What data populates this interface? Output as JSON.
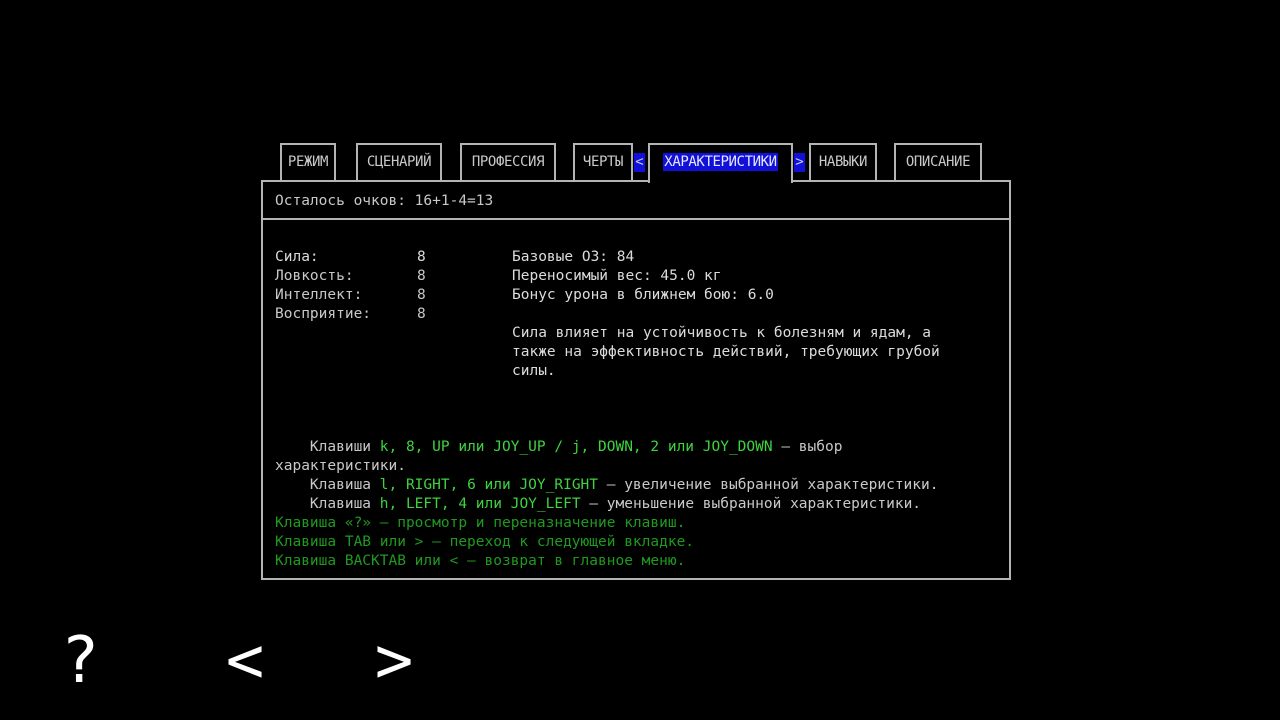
{
  "tabs": [
    {
      "label": "РЕЖИМ",
      "active": false
    },
    {
      "label": "СЦЕНАРИЙ",
      "active": false
    },
    {
      "label": "ПРОФЕССИЯ",
      "active": false
    },
    {
      "label": "ЧЕРТЫ",
      "active": false
    },
    {
      "label": "ХАРАКТЕРИСТИКИ",
      "active": true
    },
    {
      "label": "НАВЫКИ",
      "active": false
    },
    {
      "label": "ОПИСАНИЕ",
      "active": false
    }
  ],
  "active_tab_arrows": {
    "left": "<",
    "right": ">"
  },
  "points_line": "Осталось очков: 16+1-4=13",
  "stats": [
    {
      "name": "Сила:",
      "value": "8"
    },
    {
      "name": "Ловкость:",
      "value": "8"
    },
    {
      "name": "Интеллект:",
      "value": "8"
    },
    {
      "name": "Восприятие:",
      "value": "8"
    }
  ],
  "details": {
    "base_hp": "Базовые ОЗ: 84",
    "carry_weight": "Переносимый вес: 45.0 кг",
    "melee_bonus": "Бонус урона в ближнем бою: 6.0",
    "description_lines": [
      "Сила влияет на устойчивость к болезням и ядам, а",
      "также на эффективность действий, требующих грубой",
      "силы."
    ]
  },
  "help": {
    "line1_prefix": "    Клавиши ",
    "line1_keys": "k, 8, UP или JOY_UP / j, DOWN, 2 или JOY_DOWN",
    "line1_suffix": " — выбор",
    "line1_cont": "характеристики.",
    "line2_prefix": "    Клавиша ",
    "line2_keys": "l, RIGHT, 6 или JOY_RIGHT",
    "line2_suffix": " — увеличение выбранной характеристики.",
    "line3_prefix": "    Клавиша ",
    "line3_keys": "h, LEFT, 4 или JOY_LEFT",
    "line3_suffix": " — уменьшение выбранной характеристики.",
    "line4": "Клавиша «?» — просмотр и переназначение клавиш.",
    "line5": "Клавиша TAB или > — переход к следующей вкладке.",
    "line6": "Клавиша BACKTAB или < — возврат в главное меню."
  },
  "bottom_buttons": {
    "help": "?",
    "prev": "<",
    "next": ">"
  },
  "colors": {
    "background": "#000000",
    "text": "#c8c8c8",
    "highlight_bg": "#1010d8",
    "key_green": "#3ed43e",
    "hint_green": "#1f9a1f",
    "border": "#b4b4b4"
  }
}
